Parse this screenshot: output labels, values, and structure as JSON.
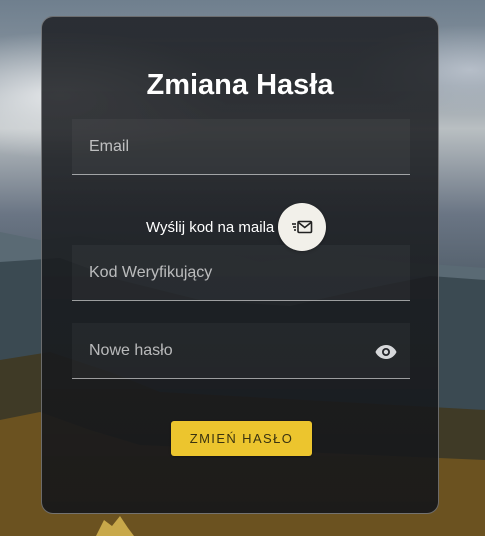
{
  "form": {
    "title": "Zmiana Hasła",
    "email_placeholder": "Email",
    "send_code_label": "Wyślij kod na maila",
    "code_placeholder": "Kod Weryfikujący",
    "new_password_placeholder": "Nowe hasło",
    "submit_label": "ZMIEŃ HASŁO"
  },
  "icons": {
    "send": "send-email-icon",
    "show_password": "eye-icon"
  },
  "colors": {
    "accent": "#ecc52e",
    "card_bg": "#1e2024",
    "text": "#ffffff",
    "send_button_bg": "#f2f0ea"
  }
}
